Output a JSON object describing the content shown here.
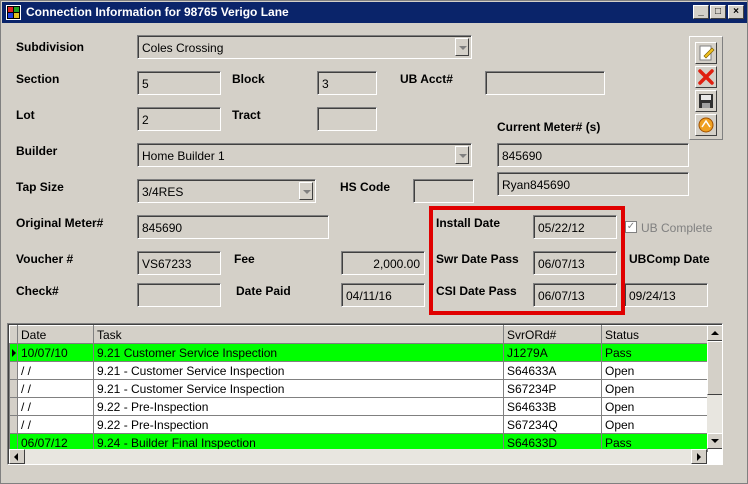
{
  "window": {
    "title": "Connection Information for 98765 Verigo Lane",
    "controls": {
      "minimize": "_",
      "restore": "□",
      "close": "×"
    }
  },
  "form": {
    "subdivision": {
      "label": "Subdivision",
      "value": "Coles Crossing"
    },
    "section": {
      "label": "Section",
      "value": "5"
    },
    "block": {
      "label": "Block",
      "value": "3"
    },
    "ub_acct": {
      "label": "UB Acct#",
      "value": ""
    },
    "lot": {
      "label": "Lot",
      "value": "2"
    },
    "tract": {
      "label": "Tract",
      "value": ""
    },
    "current_meter": {
      "label": "Current Meter# (s)",
      "values": [
        "845690",
        "Ryan845690"
      ]
    },
    "builder": {
      "label": "Builder",
      "value": "Home Builder 1"
    },
    "tap_size": {
      "label": "Tap Size",
      "value": "3/4RES"
    },
    "hs_code": {
      "label": "HS Code",
      "value": ""
    },
    "original_meter": {
      "label": "Original Meter#",
      "value": "845690"
    },
    "install_date": {
      "label": "Install Date",
      "value": "05/22/12"
    },
    "ub_complete": {
      "label": "UB Complete",
      "checked": true
    },
    "voucher": {
      "label": "Voucher #",
      "value": "VS67233"
    },
    "fee": {
      "label": "Fee",
      "value": "2,000.00"
    },
    "swr_date_pass": {
      "label": "Swr Date Pass",
      "value": "06/07/13"
    },
    "ubcomp_date": {
      "label": "UBComp Date",
      "value": "09/24/13"
    },
    "check": {
      "label": "Check#",
      "value": ""
    },
    "date_paid": {
      "label": "Date Paid",
      "value": "04/11/16"
    },
    "csi_date_pass": {
      "label": "CSI Date Pass",
      "value": "06/07/13"
    }
  },
  "toolbar": {
    "icons": [
      "edit-icon",
      "delete-icon",
      "save-icon",
      "print-icon"
    ]
  },
  "grid": {
    "columns": [
      "Date",
      "Task",
      "SvrORd#",
      "Status"
    ],
    "rows": [
      {
        "date": "10/07/10",
        "task": "9.21 Customer Service Inspection",
        "order": "J1279A",
        "status": "Pass",
        "highlight": "#00ff00"
      },
      {
        "date": "/ /",
        "task": "9.21 - Customer Service Inspection",
        "order": "S64633A",
        "status": "Open"
      },
      {
        "date": "/ /",
        "task": "9.21 - Customer Service Inspection",
        "order": "S67234P",
        "status": "Open"
      },
      {
        "date": "/ /",
        "task": "9.22 - Pre-Inspection",
        "order": "S64633B",
        "status": "Open"
      },
      {
        "date": "/ /",
        "task": "9.22 - Pre-Inspection",
        "order": "S67234Q",
        "status": "Open"
      },
      {
        "date": "06/07/12",
        "task": "9.24 - Builder Final Inspection",
        "order": "S64633D",
        "status": "Pass",
        "highlight": "#00ff00"
      }
    ]
  },
  "colors": {
    "title_bar": "#0a246a",
    "highlight_box": "#e00000",
    "pass_row": "#00ff00"
  }
}
